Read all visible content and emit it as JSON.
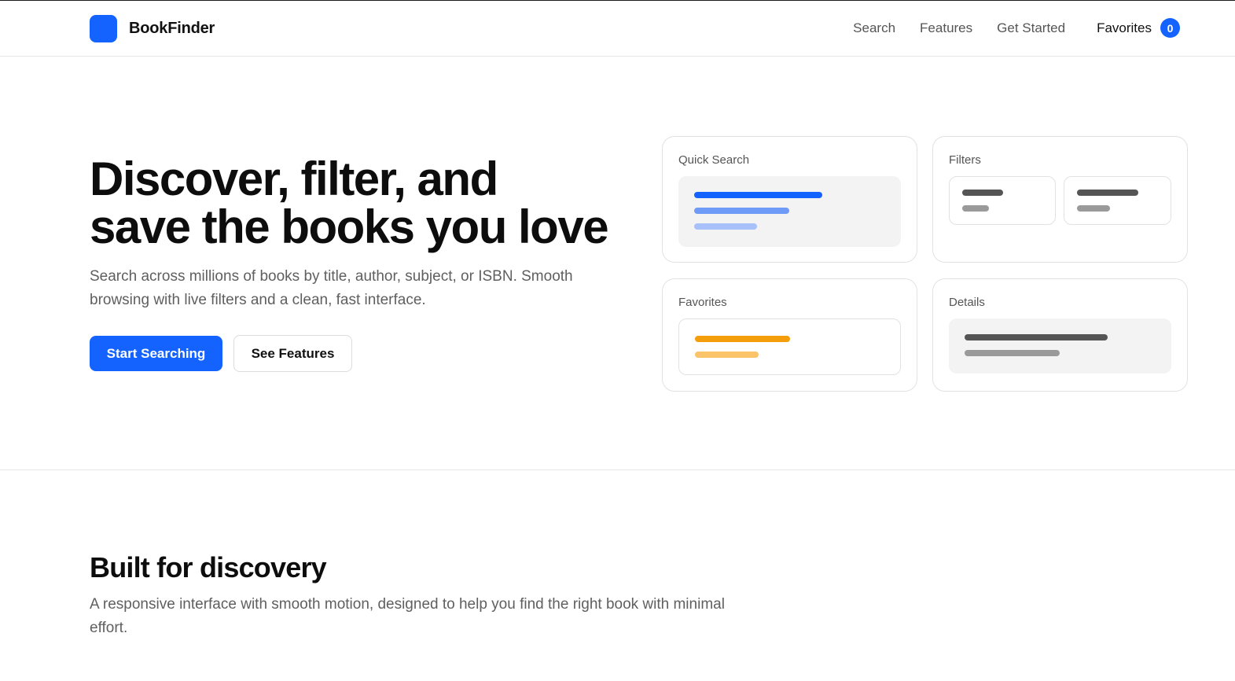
{
  "header": {
    "brand_name": "BookFinder",
    "nav": [
      "Search",
      "Features",
      "Get Started"
    ],
    "favorites_label": "Favorites",
    "favorites_count": "0"
  },
  "hero": {
    "title_line1": "Discover, filter, and",
    "title_line2": "save the books you love",
    "subtitle": "Search across millions of books by title, author, subject, or ISBN. Smooth browsing with live filters and a clean, fast interface.",
    "primary_button": "Start Searching",
    "secondary_button": "See Features"
  },
  "preview_cards": {
    "quick_search": "Quick Search",
    "filters": "Filters",
    "favorites": "Favorites",
    "details": "Details"
  },
  "features_section": {
    "title": "Built for discovery",
    "subtitle": "A responsive interface with smooth motion, designed to help you find the right book with minimal effort."
  },
  "colors": {
    "accent": "#1463ff",
    "favorites_accent": "#f59e0b"
  }
}
